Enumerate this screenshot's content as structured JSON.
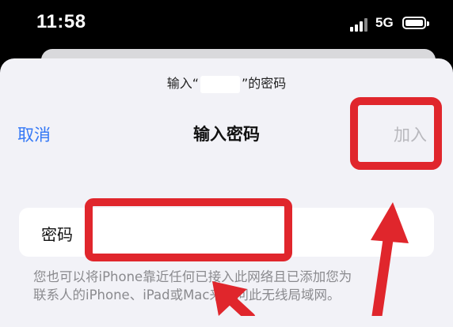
{
  "status_bar": {
    "time": "11:58",
    "network": "5G",
    "icons": [
      "signal-icon",
      "battery-icon"
    ]
  },
  "sheet": {
    "prompt_prefix": "输入“",
    "prompt_suffix": "”的密码",
    "cancel_label": "取消",
    "title": "输入密码",
    "join_label": "加入",
    "password_label": "密码",
    "password_value": "",
    "footnote_line1": "您也可以将iPhone靠近任何已接入此网络且已添加您为",
    "footnote_line2": "联系人的iPhone、iPad或Mac来访问此无线局域网。"
  },
  "colors": {
    "accent": "#3478f6",
    "annotation_red": "#e0262c",
    "disabled": "#b8b8bd",
    "sheet_bg": "#f2f2f7"
  }
}
